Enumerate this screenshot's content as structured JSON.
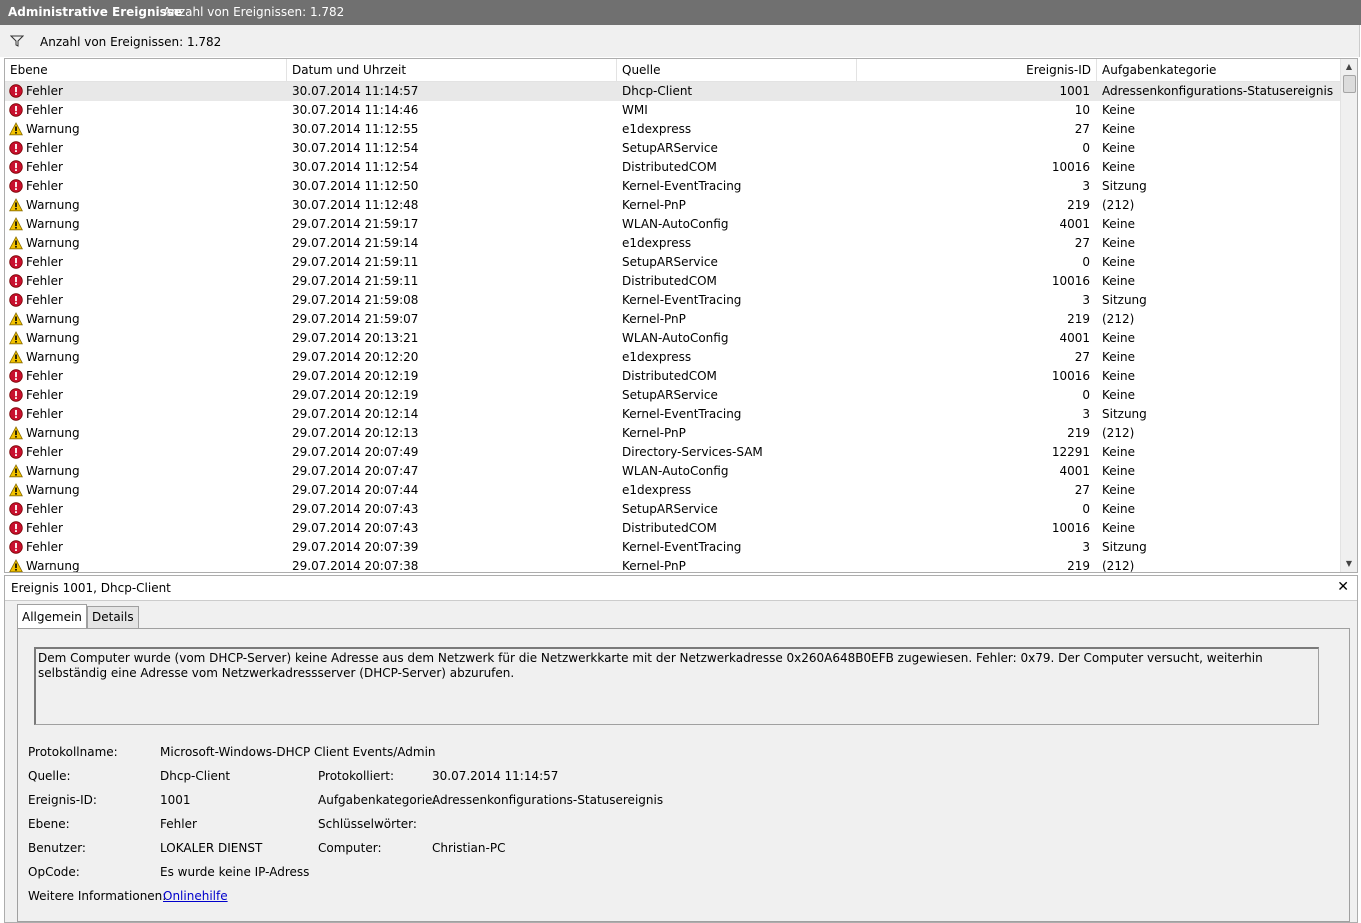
{
  "titlebar": {
    "title": "Administrative Ereignisse",
    "count": "Anzahl von Ereignissen: 1.782"
  },
  "filterbar": {
    "text": "Anzahl von Ereignissen: 1.782"
  },
  "columns": {
    "level": "Ebene",
    "date": "Datum und Uhrzeit",
    "source": "Quelle",
    "id": "Ereignis-ID",
    "category": "Aufgabenkategorie"
  },
  "rows": [
    {
      "level": "Fehler",
      "type": "error",
      "date": "30.07.2014 11:14:57",
      "source": "Dhcp-Client",
      "id": "1001",
      "category": "Adressenkonfigurations-Statusereignis"
    },
    {
      "level": "Fehler",
      "type": "error",
      "date": "30.07.2014 11:14:46",
      "source": "WMI",
      "id": "10",
      "category": "Keine"
    },
    {
      "level": "Warnung",
      "type": "warning",
      "date": "30.07.2014 11:12:55",
      "source": "e1dexpress",
      "id": "27",
      "category": "Keine"
    },
    {
      "level": "Fehler",
      "type": "error",
      "date": "30.07.2014 11:12:54",
      "source": "SetupARService",
      "id": "0",
      "category": "Keine"
    },
    {
      "level": "Fehler",
      "type": "error",
      "date": "30.07.2014 11:12:54",
      "source": "DistributedCOM",
      "id": "10016",
      "category": "Keine"
    },
    {
      "level": "Fehler",
      "type": "error",
      "date": "30.07.2014 11:12:50",
      "source": "Kernel-EventTracing",
      "id": "3",
      "category": "Sitzung"
    },
    {
      "level": "Warnung",
      "type": "warning",
      "date": "30.07.2014 11:12:48",
      "source": "Kernel-PnP",
      "id": "219",
      "category": "(212)"
    },
    {
      "level": "Warnung",
      "type": "warning",
      "date": "29.07.2014 21:59:17",
      "source": "WLAN-AutoConfig",
      "id": "4001",
      "category": "Keine"
    },
    {
      "level": "Warnung",
      "type": "warning",
      "date": "29.07.2014 21:59:14",
      "source": "e1dexpress",
      "id": "27",
      "category": "Keine"
    },
    {
      "level": "Fehler",
      "type": "error",
      "date": "29.07.2014 21:59:11",
      "source": "SetupARService",
      "id": "0",
      "category": "Keine"
    },
    {
      "level": "Fehler",
      "type": "error",
      "date": "29.07.2014 21:59:11",
      "source": "DistributedCOM",
      "id": "10016",
      "category": "Keine"
    },
    {
      "level": "Fehler",
      "type": "error",
      "date": "29.07.2014 21:59:08",
      "source": "Kernel-EventTracing",
      "id": "3",
      "category": "Sitzung"
    },
    {
      "level": "Warnung",
      "type": "warning",
      "date": "29.07.2014 21:59:07",
      "source": "Kernel-PnP",
      "id": "219",
      "category": "(212)"
    },
    {
      "level": "Warnung",
      "type": "warning",
      "date": "29.07.2014 20:13:21",
      "source": "WLAN-AutoConfig",
      "id": "4001",
      "category": "Keine"
    },
    {
      "level": "Warnung",
      "type": "warning",
      "date": "29.07.2014 20:12:20",
      "source": "e1dexpress",
      "id": "27",
      "category": "Keine"
    },
    {
      "level": "Fehler",
      "type": "error",
      "date": "29.07.2014 20:12:19",
      "source": "DistributedCOM",
      "id": "10016",
      "category": "Keine"
    },
    {
      "level": "Fehler",
      "type": "error",
      "date": "29.07.2014 20:12:19",
      "source": "SetupARService",
      "id": "0",
      "category": "Keine"
    },
    {
      "level": "Fehler",
      "type": "error",
      "date": "29.07.2014 20:12:14",
      "source": "Kernel-EventTracing",
      "id": "3",
      "category": "Sitzung"
    },
    {
      "level": "Warnung",
      "type": "warning",
      "date": "29.07.2014 20:12:13",
      "source": "Kernel-PnP",
      "id": "219",
      "category": "(212)"
    },
    {
      "level": "Fehler",
      "type": "error",
      "date": "29.07.2014 20:07:49",
      "source": "Directory-Services-SAM",
      "id": "12291",
      "category": "Keine"
    },
    {
      "level": "Warnung",
      "type": "warning",
      "date": "29.07.2014 20:07:47",
      "source": "WLAN-AutoConfig",
      "id": "4001",
      "category": "Keine"
    },
    {
      "level": "Warnung",
      "type": "warning",
      "date": "29.07.2014 20:07:44",
      "source": "e1dexpress",
      "id": "27",
      "category": "Keine"
    },
    {
      "level": "Fehler",
      "type": "error",
      "date": "29.07.2014 20:07:43",
      "source": "SetupARService",
      "id": "0",
      "category": "Keine"
    },
    {
      "level": "Fehler",
      "type": "error",
      "date": "29.07.2014 20:07:43",
      "source": "DistributedCOM",
      "id": "10016",
      "category": "Keine"
    },
    {
      "level": "Fehler",
      "type": "error",
      "date": "29.07.2014 20:07:39",
      "source": "Kernel-EventTracing",
      "id": "3",
      "category": "Sitzung"
    },
    {
      "level": "Warnung",
      "type": "warning",
      "date": "29.07.2014 20:07:38",
      "source": "Kernel-PnP",
      "id": "219",
      "category": "(212)"
    }
  ],
  "detail": {
    "title": "Ereignis 1001, Dhcp-Client",
    "close": "✕",
    "tabs": {
      "general": "Allgemein",
      "details": "Details"
    },
    "message": "Dem Computer wurde (vom DHCP-Server) keine Adresse aus dem Netzwerk für die Netzwerkkarte mit der Netzwerkadresse 0x260A648B0EFB zugewiesen. Fehler: 0x79. Der Computer versucht, weiterhin selbständig eine Adresse vom Netzwerkadressserver (DHCP-Server) abzurufen.",
    "fields": {
      "logname_label": "Protokollname:",
      "logname": "Microsoft-Windows-DHCP Client Events/Admin",
      "source_label": "Quelle:",
      "source": "Dhcp-Client",
      "logged_label": "Protokolliert:",
      "logged": "30.07.2014 11:14:57",
      "eventid_label": "Ereignis-ID:",
      "eventid": "1001",
      "category_label": "Aufgabenkategorie:",
      "category": "Adressenkonfigurations-Statusereignis",
      "level_label": "Ebene:",
      "level": "Fehler",
      "keywords_label": "Schlüsselwörter:",
      "user_label": "Benutzer:",
      "user": "LOKALER DIENST",
      "computer_label": "Computer:",
      "computer": "Christian-PC",
      "opcode_label": "OpCode:",
      "opcode": "Es wurde keine IP-Adresse zu",
      "moreinfo_label": "Weitere Informationen:",
      "moreinfo_link": "Onlinehilfe"
    }
  },
  "colors": {
    "error": "#c8102e",
    "warning": "#f2c200",
    "titlebar": "#707070"
  }
}
